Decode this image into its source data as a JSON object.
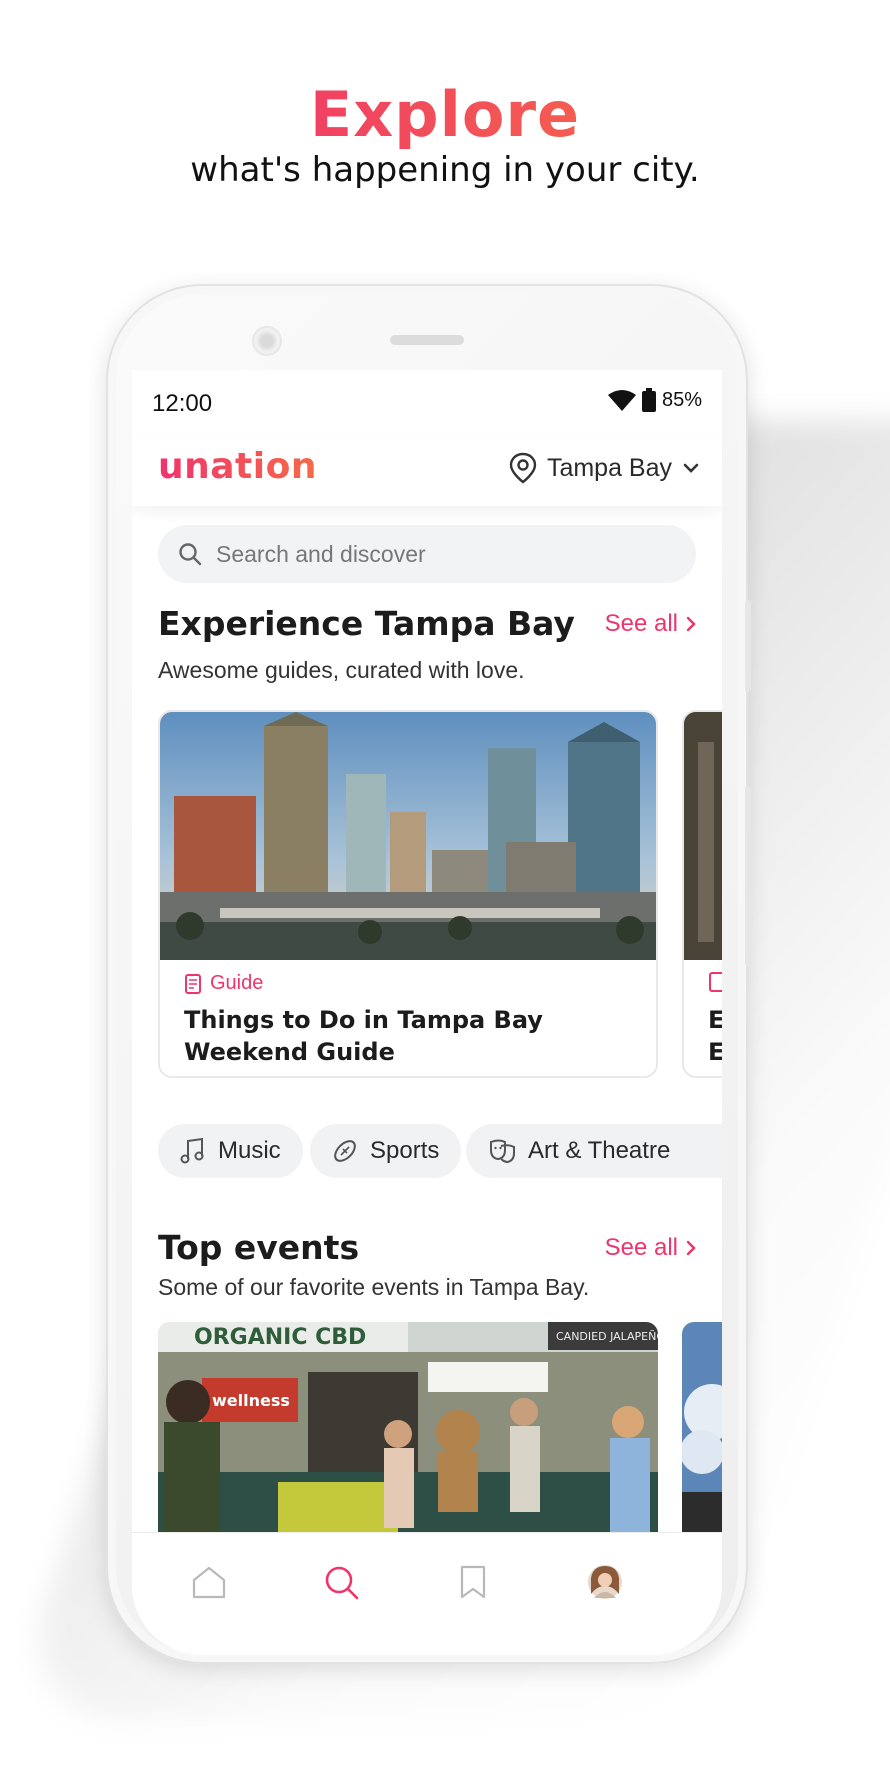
{
  "promo": {
    "title": "Explore",
    "subtitle": "what's happening in your city."
  },
  "status_bar": {
    "time": "12:00",
    "battery": "85%"
  },
  "app_bar": {
    "logo": "unation",
    "location": "Tampa Bay"
  },
  "search": {
    "placeholder": "Search and discover"
  },
  "experience": {
    "title": "Experience Tampa Bay",
    "subtitle": "Awesome guides, curated with love.",
    "see_all": "See all",
    "cards": [
      {
        "tag": "Guide",
        "title": "Things to Do in Tampa Bay Weekend Guide"
      },
      {
        "tag": "",
        "title": "E E"
      }
    ]
  },
  "categories": [
    {
      "label": "Music",
      "icon": "music-note-icon"
    },
    {
      "label": "Sports",
      "icon": "football-icon"
    },
    {
      "label": "Art & Theatre",
      "icon": "theatre-masks-icon"
    }
  ],
  "top_events": {
    "title": "Top events",
    "subtitle": "Some of our favorite events in Tampa Bay.",
    "see_all": "See all",
    "image_signs": [
      "ORGANIC CBD",
      "wellness",
      "CANDIED JALAPEÑOS"
    ]
  },
  "bottom_nav": {
    "items": [
      "home-icon",
      "search-icon",
      "bookmark-icon",
      "profile-avatar"
    ],
    "active": "search-icon"
  },
  "colors": {
    "brand_pink": "#f0336b",
    "brand_orange": "#f56a47"
  }
}
